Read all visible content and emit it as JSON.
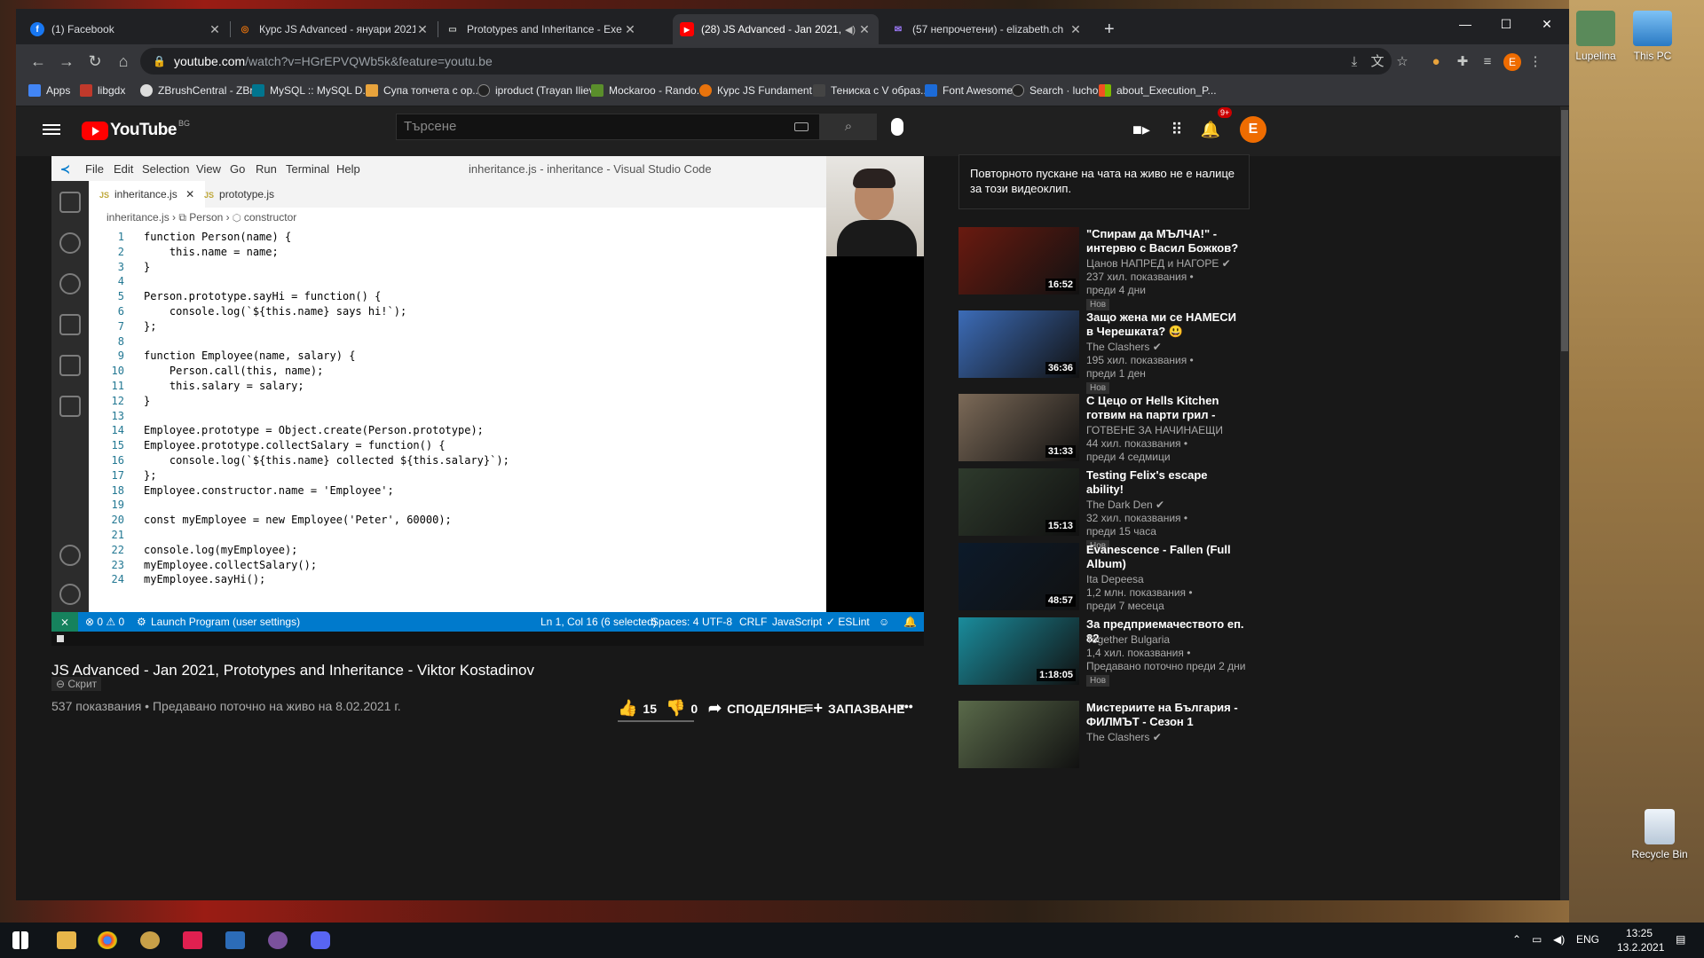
{
  "desktop": {
    "icons": [
      {
        "label": "Lupelina"
      },
      {
        "label": "This PC"
      },
      {
        "label": "Recycle Bin"
      }
    ]
  },
  "browser": {
    "tabs": [
      {
        "title": "(1) Facebook",
        "color": "#1877f2",
        "glyph": "f"
      },
      {
        "title": "Курс JS Advanced - януари 2021",
        "color": "#e8730c",
        "glyph": "◎"
      },
      {
        "title": "Prototypes and Inheritance - Exe",
        "color": "#5f6368",
        "glyph": "▭"
      },
      {
        "title": "(28) JS Advanced - Jan 2021,",
        "color": "#f00",
        "glyph": "▶"
      },
      {
        "title": "(57 непрочетени) - elizabeth.ch",
        "color": "#6001d2",
        "glyph": "✉"
      }
    ],
    "newtab": "+",
    "url_host": "youtube.com",
    "url_path": "/watch?v=HGrEPVQWb5k&feature=youtu.be",
    "profile_letter": "E",
    "bookmarks": [
      {
        "label": "Apps",
        "color": "#4285f4"
      },
      {
        "label": "libgdx",
        "color": "#c0392b"
      },
      {
        "label": "ZBrushCentral - ZBr...",
        "color": "#ddd"
      },
      {
        "label": "MySQL :: MySQL D...",
        "color": "#00758f"
      },
      {
        "label": "Супа топчета с ор...",
        "color": "#e8a33c"
      },
      {
        "label": "iproduct (Trayan Iliev)",
        "color": "#222"
      },
      {
        "label": "Mockaroo - Rando...",
        "color": "#5a8e2b"
      },
      {
        "label": "Курс JS Fundament...",
        "color": "#e8730c"
      },
      {
        "label": "Тениска с V образ...",
        "color": "#444"
      },
      {
        "label": "Font Awesome",
        "color": "#1c6bd8"
      },
      {
        "label": "Search · luchob",
        "color": "#222"
      },
      {
        "label": "about_Execution_P...",
        "color": "#f25022"
      }
    ]
  },
  "youtube": {
    "logo": "YouTube",
    "country": "BG",
    "search_placeholder": "Търсене",
    "bell_badge": "9+",
    "avatar_letter": "E",
    "video_title": "JS Advanced - Jan 2021, Prototypes and Inheritance - Viktor Kostadinov",
    "privacy": "⊖ Скрит",
    "views_line": "537 показвания • Предавано поточно на живо на 8.02.2021 г.",
    "likes": "15",
    "dislikes": "0",
    "share": "СПОДЕЛЯНЕ",
    "save": "ЗАПАЗВАНЕ",
    "more": "•••",
    "chat_notice": "Повторното пускане на чата на живо не е налице за този видеоклип.",
    "recommendations": [
      {
        "title": "\"Спирам да МЪЛЧА!\" - интервю с Васил Божков?",
        "channel": "Цанов НАПРЕД и НАГОРЕ ✔",
        "views": "237 хил. показвания •",
        "age": "преди 4 дни",
        "badge": "Нов",
        "duration": "16:52",
        "thumb": "#6a1a10"
      },
      {
        "title": "Защо жена ми се НАМЕСИ в Черешката? 😃 РЕАГИРАМЕ ...",
        "channel": "The Clashers ✔",
        "views": "195 хил. показвания •",
        "age": "преди 1 ден",
        "badge": "Нов",
        "duration": "36:36",
        "thumb": "#3c6cb8"
      },
      {
        "title": "С Цецо от Hells Kitchen готвим на парти грил - вижте какво...",
        "channel": "ГОТВЕНЕ ЗА НАЧИНАЕЩИ",
        "views": "44 хил. показвания •",
        "age": "преди 4 седмици",
        "badge": "",
        "duration": "31:33",
        "thumb": "#7c6a58"
      },
      {
        "title": "Testing Felix's escape ability!",
        "channel": "The Dark Den ✔",
        "views": "32 хил. показвания •",
        "age": "преди 15 часа",
        "badge": "Нов",
        "duration": "15:13",
        "thumb": "#2e3a2c"
      },
      {
        "title": "Evanescence - Fallen (Full Album)",
        "channel": "Ita Depeesa",
        "views": "1,2 млн. показвания •",
        "age": "преди 7 месеца",
        "badge": "",
        "duration": "48:57",
        "thumb": "#0c1a2a"
      },
      {
        "title": "За предприемачеството еп. 82",
        "channel": "Together Bulgaria",
        "views": "1,4 хил. показвания •",
        "age": "Предавано поточно преди 2 дни",
        "badge": "Нов",
        "duration": "1:18:05",
        "thumb": "#1a8c9c"
      },
      {
        "title": "Мистериите на България - ФИЛМЪТ - Сезон 1",
        "channel": "The Clashers ✔",
        "views": "",
        "age": "",
        "badge": "",
        "duration": "",
        "thumb": "#5a6a4a"
      }
    ]
  },
  "vscode": {
    "menu": [
      "File",
      "Edit",
      "Selection",
      "View",
      "Go",
      "Run",
      "Terminal",
      "Help"
    ],
    "window_title": "inheritance.js - inheritance - Visual Studio Code",
    "tabs": [
      {
        "label": "inheritance.js",
        "badge": "JS",
        "active": true
      },
      {
        "label": "prototype.js",
        "badge": "JS",
        "active": false
      }
    ],
    "breadcrumb": "inheritance.js  ›  ⧉ Person  ›  ⬡ constructor",
    "lines": [
      "function Person(name) {",
      "    this.name = name;",
      "}",
      "",
      "Person.prototype.sayHi = function() {",
      "    console.log(`${this.name} says hi!`);",
      "};",
      "",
      "function Employee(name, salary) {",
      "    Person.call(this, name);",
      "    this.salary = salary;",
      "}",
      "",
      "Employee.prototype = Object.create(Person.prototype);",
      "Employee.prototype.collectSalary = function() {",
      "    console.log(`${this.name} collected ${this.salary}`);",
      "};",
      "Employee.constructor.name = 'Employee';",
      "",
      "const myEmployee = new Employee('Peter', 60000);",
      "",
      "console.log(myEmployee);",
      "myEmployee.collectSalary();",
      "myEmployee.sayHi();"
    ],
    "status": {
      "problems": "⊗ 0 ⚠ 0",
      "launch": "Launch Program (user settings)",
      "position": "Ln 1, Col 16 (6 selected)",
      "spaces": "Spaces: 4",
      "encoding": "UTF-8",
      "eol": "CRLF",
      "language": "JavaScript",
      "lint": "✓ ESLint"
    }
  },
  "taskbar": {
    "lang": "ENG",
    "time": "13:25",
    "date": "13.2.2021"
  }
}
